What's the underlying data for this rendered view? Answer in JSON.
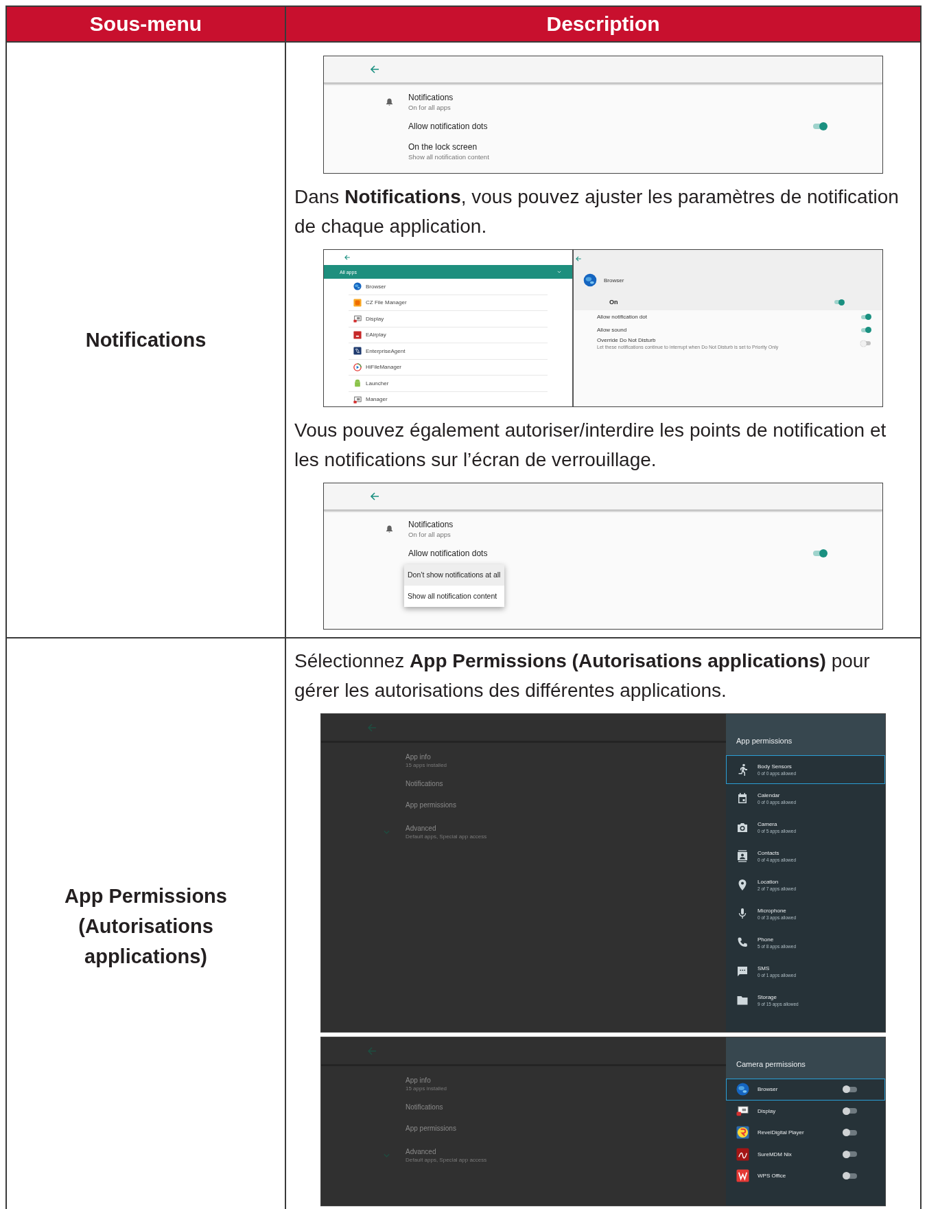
{
  "table": {
    "columns": [
      "Sous-menu",
      "Description"
    ],
    "rows": [
      {
        "submenu": "Notifications",
        "content": [
          {
            "kind": "settings_screen",
            "items": [
              {
                "kind": "entry",
                "title": "Notifications",
                "subtitle": "On for all apps"
              },
              {
                "kind": "switch",
                "title": "Allow notification dots",
                "on": true
              },
              {
                "kind": "entry",
                "title": "On the lock screen",
                "subtitle": "Show all notification content"
              }
            ]
          },
          {
            "kind": "paragraph",
            "text": "Dans **Notifications**, vous pouvez ajuster les paramètres de notification de chaque application."
          },
          {
            "kind": "app_screen",
            "list_header": "All apps",
            "apps": [
              "Browser",
              "CZ File Manager",
              "Display",
              "EAirplay",
              "EnterpriseAgent",
              "HiFileManager",
              "Launcher",
              "Manager"
            ],
            "app": "Browser",
            "main": {
              "title": "On",
              "on": true
            },
            "settings": [
              {
                "title": "Allow notification dot",
                "on": true
              },
              {
                "title": "Allow sound",
                "on": true
              },
              {
                "title": "Override Do Not Disturb",
                "subtitle": "Let these notifications continue to interrupt when Do Not Disturb is set to Priority Only",
                "on": false
              }
            ]
          },
          {
            "kind": "paragraph",
            "text": "Vous pouvez également autoriser/interdire les points de notification et les notifications sur l’écran de verrouillage."
          },
          {
            "kind": "settings_screen",
            "items": [
              {
                "kind": "entry",
                "title": "Notifications",
                "subtitle": "On for all apps"
              },
              {
                "kind": "switch",
                "title": "Allow notification dots",
                "on": true
              }
            ],
            "menu": [
              {
                "label": "Don’t show notifications at all",
                "selected": true
              },
              {
                "label": "Show all notification content",
                "selected": false
              }
            ]
          }
        ]
      },
      {
        "submenu": "App Permissions (Autorisations applications)",
        "content": [
          {
            "kind": "paragraph",
            "text": "Sélectionnez **App Permissions (Autorisations applications)** pour gérer les autorisations des différentes applications."
          },
          {
            "kind": "permissions_screen",
            "background": [
              {
                "title": "App info",
                "subtitle": "15 apps installed"
              },
              {
                "title": "Notifications"
              },
              {
                "title": "App permissions"
              },
              {
                "title": "Advanced",
                "subtitle": "Default apps, Special app access"
              }
            ],
            "panel": {
              "title": "App permissions",
              "kind": "groups",
              "items": [
                {
                  "title": "Body Sensors",
                  "subtitle": "0 of 0 apps allowed",
                  "selected": true
                },
                {
                  "title": "Calendar",
                  "subtitle": "0 of 0 apps allowed",
                  "selected": false
                },
                {
                  "title": "Camera",
                  "subtitle": "0 of 5 apps allowed",
                  "selected": false
                },
                {
                  "title": "Contacts",
                  "subtitle": "0 of 4 apps allowed",
                  "selected": false
                },
                {
                  "title": "Location",
                  "subtitle": "2 of 7 apps allowed",
                  "selected": false
                },
                {
                  "title": "Microphone",
                  "subtitle": "0 of 3 apps allowed",
                  "selected": false
                },
                {
                  "title": "Phone",
                  "subtitle": "5 of 8 apps allowed",
                  "selected": false
                },
                {
                  "title": "SMS",
                  "subtitle": "0 of 1 apps allowed",
                  "selected": false
                },
                {
                  "title": "Storage",
                  "subtitle": "9 of 15 apps allowed",
                  "selected": false
                }
              ]
            }
          },
          {
            "kind": "permissions_screen",
            "background": [
              {
                "title": "App info",
                "subtitle": "15 apps installed"
              },
              {
                "title": "Notifications"
              },
              {
                "title": "App permissions"
              },
              {
                "title": "Advanced",
                "subtitle": "Default apps, Special app access"
              }
            ],
            "panel": {
              "title": "Camera permissions",
              "kind": "apps",
              "items": [
                {
                  "title": "Browser",
                  "selected": true,
                  "on": false
                },
                {
                  "title": "Display",
                  "selected": false,
                  "on": false
                },
                {
                  "title": "RevelDigital Player",
                  "selected": false,
                  "on": false
                },
                {
                  "title": "SureMDM Nix",
                  "selected": false,
                  "on": false
                },
                {
                  "title": "WPS Office",
                  "selected": false,
                  "on": false
                }
              ]
            }
          }
        ]
      }
    ]
  }
}
